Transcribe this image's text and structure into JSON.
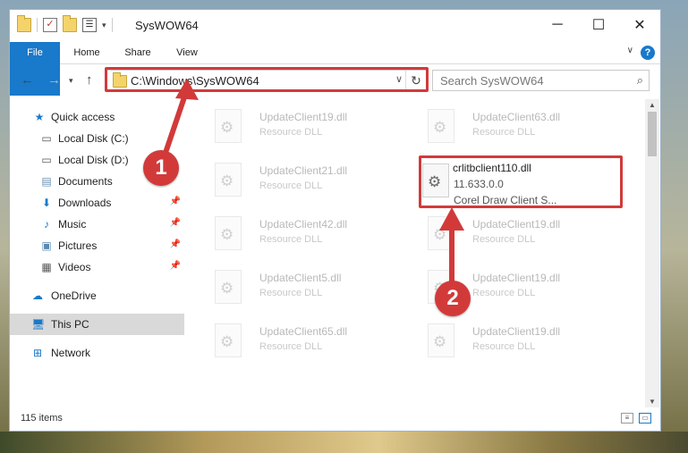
{
  "window": {
    "title": "SysWOW64",
    "controls": {
      "minimize": "─",
      "maximize": "☐",
      "close": "✕"
    }
  },
  "ribbon": {
    "tabs": [
      "File",
      "Home",
      "Share",
      "View"
    ],
    "help": "?"
  },
  "navigation": {
    "address": "C:\\Windows\\SysWOW64",
    "search_placeholder": "Search SysWOW64"
  },
  "sidebar": {
    "items": [
      {
        "label": "Quick access",
        "icon": "star-icon"
      },
      {
        "label": "Local Disk (C:)",
        "icon": "drive-icon"
      },
      {
        "label": "Local Disk (D:)",
        "icon": "drive-icon"
      },
      {
        "label": "Documents",
        "icon": "documents-icon"
      },
      {
        "label": "Downloads",
        "icon": "download-icon"
      },
      {
        "label": "Music",
        "icon": "music-icon"
      },
      {
        "label": "Pictures",
        "icon": "pictures-icon"
      },
      {
        "label": "Videos",
        "icon": "videos-icon"
      },
      {
        "label": "OneDrive",
        "icon": "cloud-icon"
      },
      {
        "label": "This PC",
        "icon": "computer-icon"
      },
      {
        "label": "Network",
        "icon": "network-icon"
      }
    ]
  },
  "files": {
    "left": [
      {
        "name": "UpdateClient19.dll",
        "desc": "Resource DLL"
      },
      {
        "name": "UpdateClient21.dll",
        "desc": "Resource DLL"
      },
      {
        "name": "UpdateClient42.dll",
        "desc": "Resource DLL"
      },
      {
        "name": "UpdateClient5.dll",
        "desc": "Resource DLL"
      },
      {
        "name": "UpdateClient65.dll",
        "desc": "Resource DLL"
      }
    ],
    "right": [
      {
        "name": "UpdateClient63.dll",
        "desc": "Resource DLL"
      },
      {
        "name": "crlitbclient110.dll",
        "desc": "11.633.0.0",
        "desc2": "Corel Draw Client S..."
      },
      {
        "name": "UpdateClient19.dll",
        "desc": "Resource DLL"
      },
      {
        "name": "UpdateClient19.dll",
        "desc": "Resource DLL"
      },
      {
        "name": "UpdateClient19.dll",
        "desc": "Resource DLL"
      }
    ]
  },
  "status": {
    "items": "115 items"
  },
  "annotations": {
    "step1": "1",
    "step2": "2"
  },
  "colors": {
    "accent": "#1979ca",
    "highlight": "#d23a3a"
  }
}
